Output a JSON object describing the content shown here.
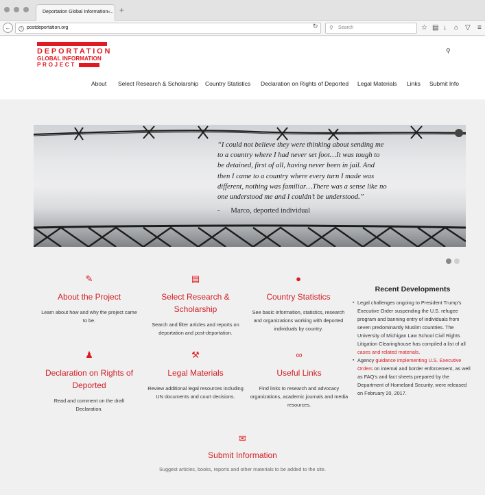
{
  "browser": {
    "tab_title": "Deportation Global Information ...",
    "tab_close": "×",
    "new_tab": "+",
    "url": "postdeportation.org",
    "search_placeholder": "Search"
  },
  "header": {
    "logo": {
      "line1": "DEPORTATION",
      "line2": "GLOBAL INFORMATION",
      "line3": "PROJECT"
    },
    "nav": [
      {
        "label": "About"
      },
      {
        "label": "Select Research & Scholarship"
      },
      {
        "label": "Country Statistics"
      },
      {
        "label": "Declaration on Rights of Deported"
      },
      {
        "label": "Legal Materials"
      },
      {
        "label": "Links"
      },
      {
        "label": "Submit Info"
      }
    ]
  },
  "banner": {
    "quote_lines": [
      "“I could not believe they were thinking about sending me",
      "to a country where I had never set foot…It was tough to",
      "be detained, first of all, having never been in jail.  And",
      "then I came to a country where every turn I made was",
      "different, nothing was familiar…There was a sense like no",
      "one understood me and I couldn’t be understood.”"
    ],
    "attribution": "-      Marco, deported individual"
  },
  "features": [
    {
      "title": "About the Project",
      "desc": [
        "Learn about how and why the project came",
        "to be."
      ],
      "icon": "pencil-icon"
    },
    {
      "title": "Select Research &",
      "title2": "Scholarship",
      "desc": [
        "Search and filter articles and reports on",
        "deportation and post-deportation."
      ],
      "icon": "book-icon"
    },
    {
      "title": "Country Statistics",
      "desc": [
        "See basic information, statistics, research",
        "and organizations working with deported",
        "individuals by country."
      ],
      "icon": "globe-icon"
    },
    {
      "title": "Declaration on Rights of",
      "title2": "Deported",
      "desc": [
        "Read and comment on the draft",
        "Declaration."
      ],
      "icon": "users-icon"
    },
    {
      "title": "Legal Materials",
      "desc": [
        "Review additional legal resources including",
        "UN documents and court decisions."
      ],
      "icon": "gavel-icon"
    },
    {
      "title": "Useful Links",
      "desc": [
        "Find links to research and advocacy",
        "organizations, academic journals and media",
        "resources."
      ],
      "icon": "link-icon"
    }
  ],
  "recent": {
    "heading": "Recent Developments",
    "item1": {
      "text": "Legal challenges ongoing to President Trump's Executive Order suspending the U.S. refugee program and banning entry of individuals from seven predominantly Muslim countries.  The University of Michigan Law School Civil Rights Litigation Clearinghouse has compiled a list of all ",
      "link": "cases and related materials",
      "end": "."
    },
    "item2": {
      "pre": "Agency ",
      "link": "guidance implementing U.S. Executive Orders",
      "text": " on internal and border enforcement, as well as FAQ's and fact sheets prepared by the Department of Homeland Security, were released on February 20, 2017."
    }
  },
  "submit": {
    "title": "Submit Information",
    "desc": "Suggest articles, books, reports and other materials to be added to the site."
  },
  "colors": {
    "accent": "#e01a22",
    "link": "#d21e25"
  }
}
